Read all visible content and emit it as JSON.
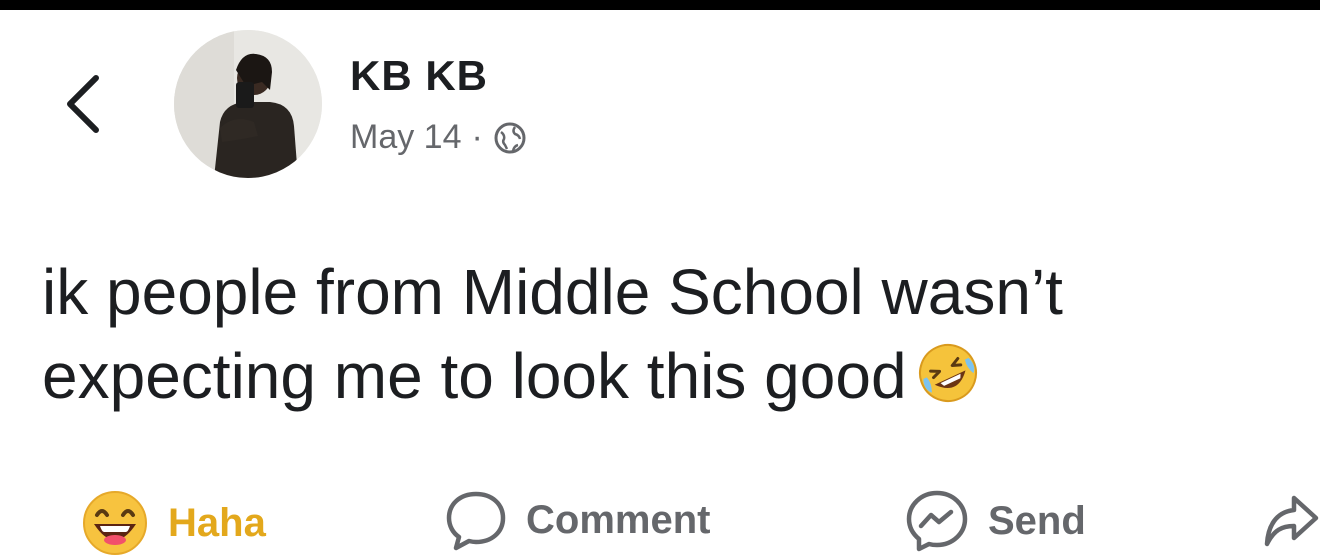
{
  "post": {
    "author": "KB KB",
    "date": "May 14",
    "separator": "·",
    "privacy_icon": "globe-icon",
    "text_line1": "ik people from Middle School wasn’t",
    "text_line2": "expecting me to look this good",
    "text_emoji": "rolling-on-floor-laughing-emoji"
  },
  "actions": {
    "reaction_label": "Haha",
    "comment_label": "Comment",
    "send_label": "Send"
  },
  "colors": {
    "haha_accent": "#e3a81c",
    "muted_text": "#65676b",
    "primary_text": "#1c1e21"
  }
}
